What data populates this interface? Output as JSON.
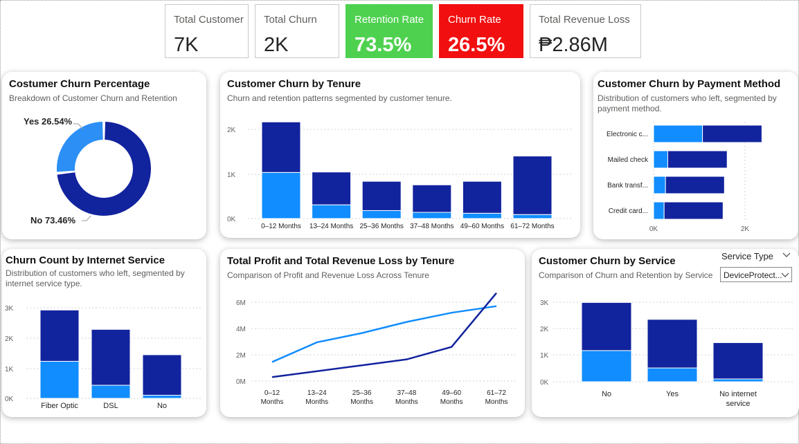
{
  "kpis": {
    "total_customer": {
      "label": "Total Customer",
      "value": "7K"
    },
    "total_churn": {
      "label": "Total Churn",
      "value": "2K"
    },
    "retention_rate": {
      "label": "Retention Rate",
      "value": "73.5%"
    },
    "churn_rate": {
      "label": "Churn Rate",
      "value": "26.5%"
    },
    "revenue_loss": {
      "label": "Total Revenue Loss",
      "value": "₱2.86M"
    }
  },
  "colors": {
    "churn_light": "#118dff",
    "retention_dark": "#12239e",
    "donut_light": "#2c8ff5",
    "retention_kpi": "#4fd150",
    "churn_kpi": "#f20f0f"
  },
  "donut_card": {
    "title": "Costumer Churn Percentage",
    "subtitle": "Breakdown of Customer Churn and Retention",
    "label_yes": "Yes 26.54%",
    "label_no": "No 73.46%"
  },
  "tenure_card": {
    "title": "Customer Churn by Tenure",
    "subtitle": "Churn and retention patterns segmented by customer tenure.",
    "y_ticks": [
      "2K",
      "1K",
      "0K"
    ]
  },
  "payment_card": {
    "title": "Customer Churn by Payment Method",
    "subtitle": "Distribution of customers who left, segmented by payment method.",
    "x_ticks": [
      "0K",
      "2K"
    ]
  },
  "internet_card": {
    "title": "Churn Count by Internet Service",
    "subtitle": "Distribution of customers who left, segmented by internet service type.",
    "y_ticks": [
      "3K",
      "2K",
      "1K",
      "0K"
    ]
  },
  "profit_card": {
    "title": "Total Profit and Total Revenue Loss by Tenure",
    "subtitle": "Comparison of Profit and Revenue Loss Across Tenure",
    "y_ticks": [
      "6M",
      "4M",
      "2M",
      "0M"
    ]
  },
  "service_card": {
    "title": "Customer Churn by Service",
    "subtitle": "Comparison of Churn and Retention by Service",
    "slicer_label": "Service Type",
    "slicer_value": "DeviceProtect...",
    "y_ticks": [
      "3K",
      "2K",
      "1K",
      "0K"
    ]
  },
  "chart_data": [
    {
      "type": "pie",
      "title": "Costumer Churn Percentage",
      "categories": [
        "Yes",
        "No"
      ],
      "values": [
        26.54,
        73.46
      ]
    },
    {
      "type": "bar",
      "title": "Customer Churn by Tenure",
      "categories": [
        "0–12 Months",
        "13–24 Months",
        "25–36 Months",
        "37–48 Months",
        "49–60 Months",
        "61–72 Months"
      ],
      "series": [
        {
          "values": [
            1040,
            310,
            180,
            140,
            120,
            90
          ]
        },
        {
          "values": [
            1140,
            740,
            660,
            620,
            720,
            1320
          ]
        }
      ],
      "ylim": [
        0,
        2200
      ]
    },
    {
      "type": "bar",
      "orientation": "horizontal",
      "title": "Customer Churn by Payment Method",
      "categories": [
        "Electronic c...",
        "Mailed check",
        "Bank transf...",
        "Credit card..."
      ],
      "series": [
        {
          "values": [
            1070,
            310,
            260,
            230
          ]
        },
        {
          "values": [
            1300,
            1300,
            1290,
            1290
          ]
        }
      ],
      "xlim": [
        0,
        2800
      ]
    },
    {
      "type": "bar",
      "title": "Churn Count by Internet Service",
      "categories": [
        "Fiber Optic",
        "DSL",
        "No"
      ],
      "series": [
        {
          "values": [
            1300,
            460,
            110
          ]
        },
        {
          "values": [
            1800,
            1960,
            1420
          ]
        }
      ],
      "ylim": [
        0,
        3300
      ]
    },
    {
      "type": "line",
      "title": "Total Profit and Total Revenue Loss by Tenure",
      "categories": [
        "0–12 Months",
        "13–24 Months",
        "25–36 Months",
        "37–48 Months",
        "49–60 Months",
        "61–72 Months"
      ],
      "series": [
        {
          "values": [
            1.45,
            2.95,
            3.65,
            4.5,
            5.2,
            5.7
          ]
        },
        {
          "values": [
            0.3,
            0.75,
            1.2,
            1.65,
            2.6,
            6.7
          ]
        }
      ],
      "ylim": [
        0,
        7
      ]
    },
    {
      "type": "bar",
      "title": "Customer Churn by Service",
      "categories": [
        "No",
        "Yes",
        "No internet service"
      ],
      "category_lines": [
        [
          "No"
        ],
        [
          "Yes"
        ],
        [
          "No internet",
          "service"
        ]
      ],
      "series": [
        {
          "values": [
            1220,
            540,
            110
          ]
        },
        {
          "values": [
            1880,
            1900,
            1420
          ]
        }
      ],
      "ylim": [
        0,
        3300
      ]
    }
  ]
}
